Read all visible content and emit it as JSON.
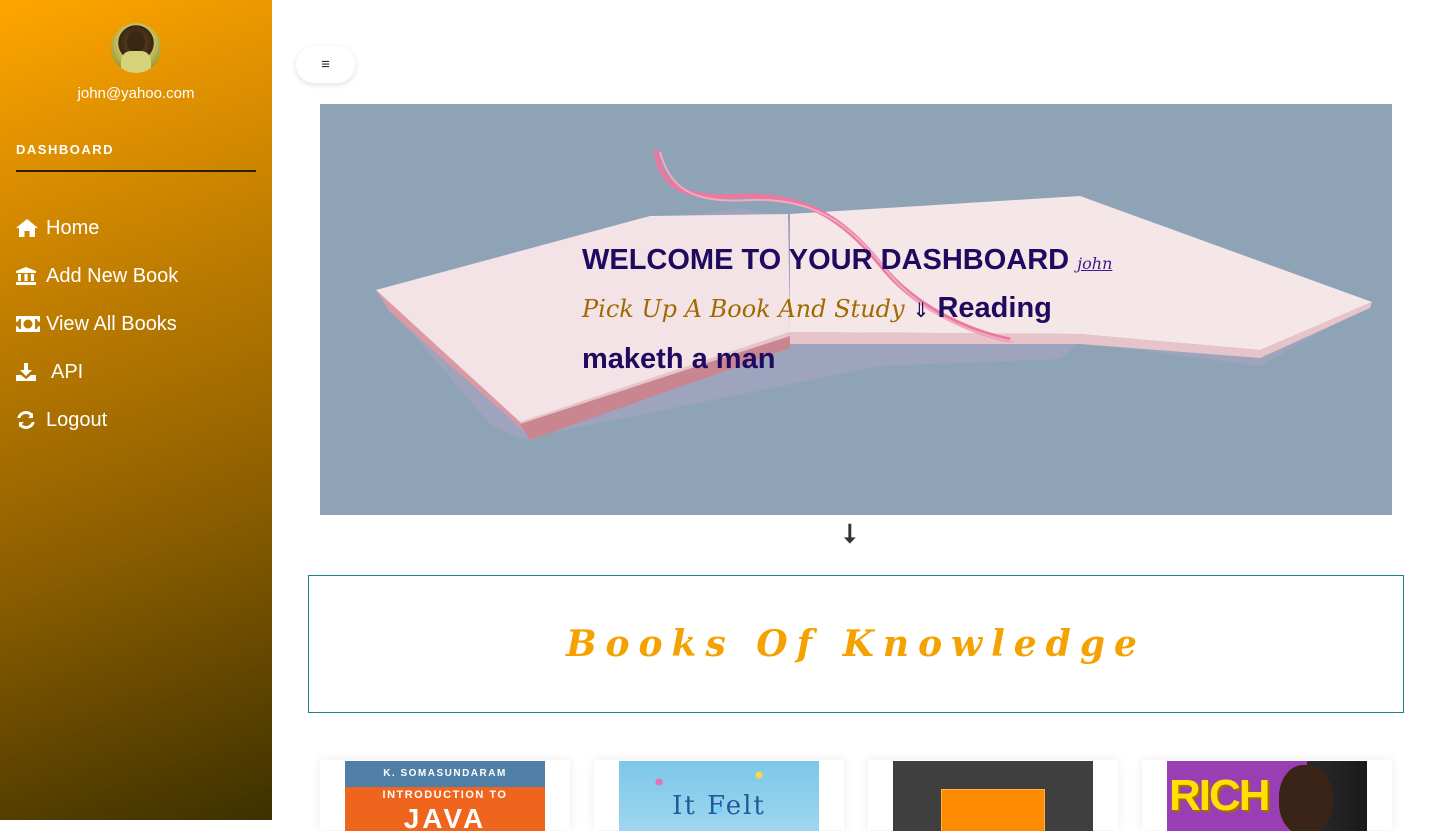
{
  "sidebar": {
    "email": "john@yahoo.com",
    "section_label": "DASHBOARD",
    "items": [
      {
        "label": "Home",
        "icon": "home-icon"
      },
      {
        "label": "Add New Book",
        "icon": "bank-icon"
      },
      {
        "label": "View All Books",
        "icon": "money-icon"
      },
      {
        "label": "API",
        "icon": "download-icon"
      },
      {
        "label": "Logout",
        "icon": "refresh-icon"
      }
    ]
  },
  "header": {
    "toggle_icon": "≡"
  },
  "hero": {
    "welcome": "WELCOME TO YOUR DASHBOARD",
    "username": "john",
    "tagline": "Pick Up A Book And Study",
    "tag_arrow": "⇓",
    "motto": "Reading maketh a man"
  },
  "down_arrow": "⭣",
  "knowledge": {
    "title": "Books Of Knowledge"
  },
  "books": [
    {
      "author": "K. SOMASUNDARAM",
      "line1": "INTRODUCTION TO",
      "line2": "JAVA"
    },
    {
      "title": "It Felt"
    },
    {
      "title": ""
    },
    {
      "title": "RICH"
    }
  ],
  "colors": {
    "sidebar_top": "#ffa500",
    "sidebar_bottom": "#3d3100",
    "hero_bg": "#8fa3b7",
    "heading": "#1e0a5e",
    "accent": "#f5a200",
    "box_border": "#19858a"
  }
}
